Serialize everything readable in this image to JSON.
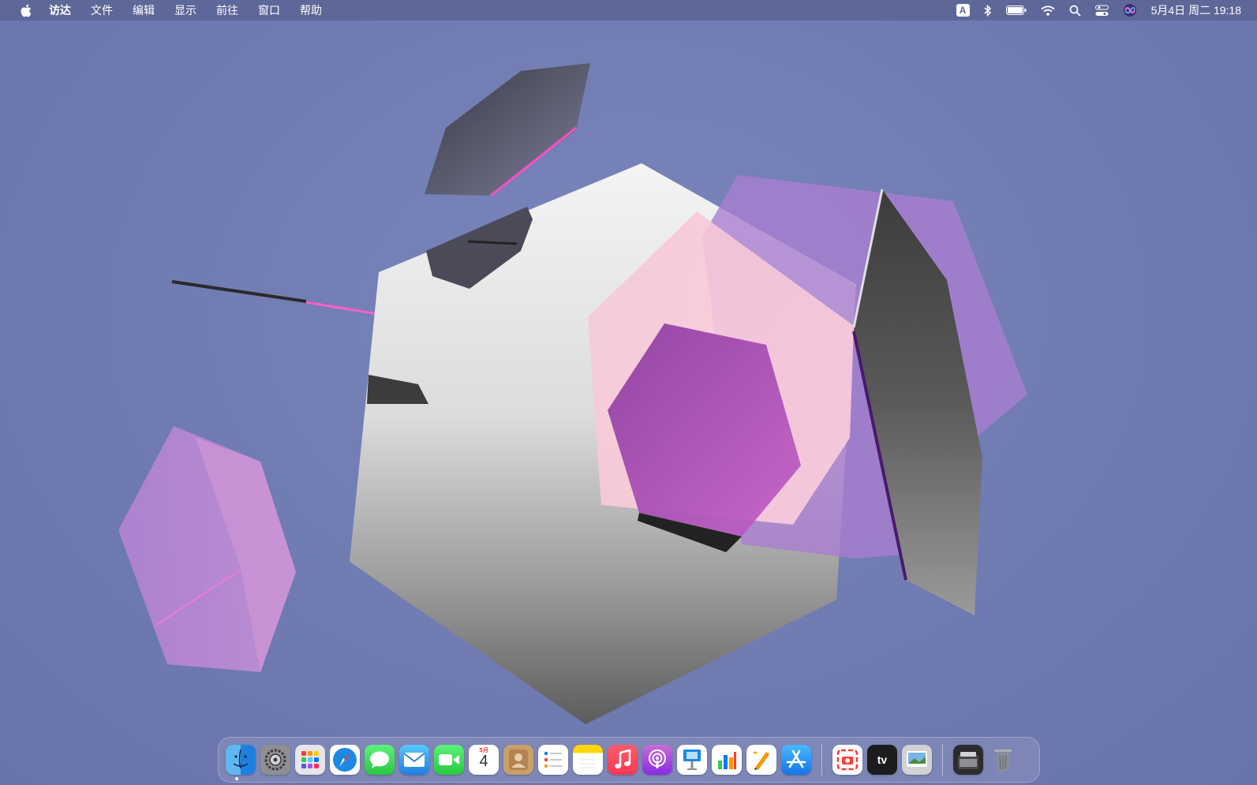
{
  "menubar": {
    "app_name": "访达",
    "menus": [
      "文件",
      "编辑",
      "显示",
      "前往",
      "窗口",
      "帮助"
    ],
    "input_source": "A",
    "clock": "5月4日 周二 19:18"
  },
  "dock": {
    "calendar_month": "5月",
    "calendar_day": "4",
    "tv_label": "tv"
  },
  "colors": {
    "desktop": "#6f7bb1",
    "menubar": "#5c6696",
    "accent_pink": "#ff66c4",
    "accent_purple": "#a04ac0"
  }
}
